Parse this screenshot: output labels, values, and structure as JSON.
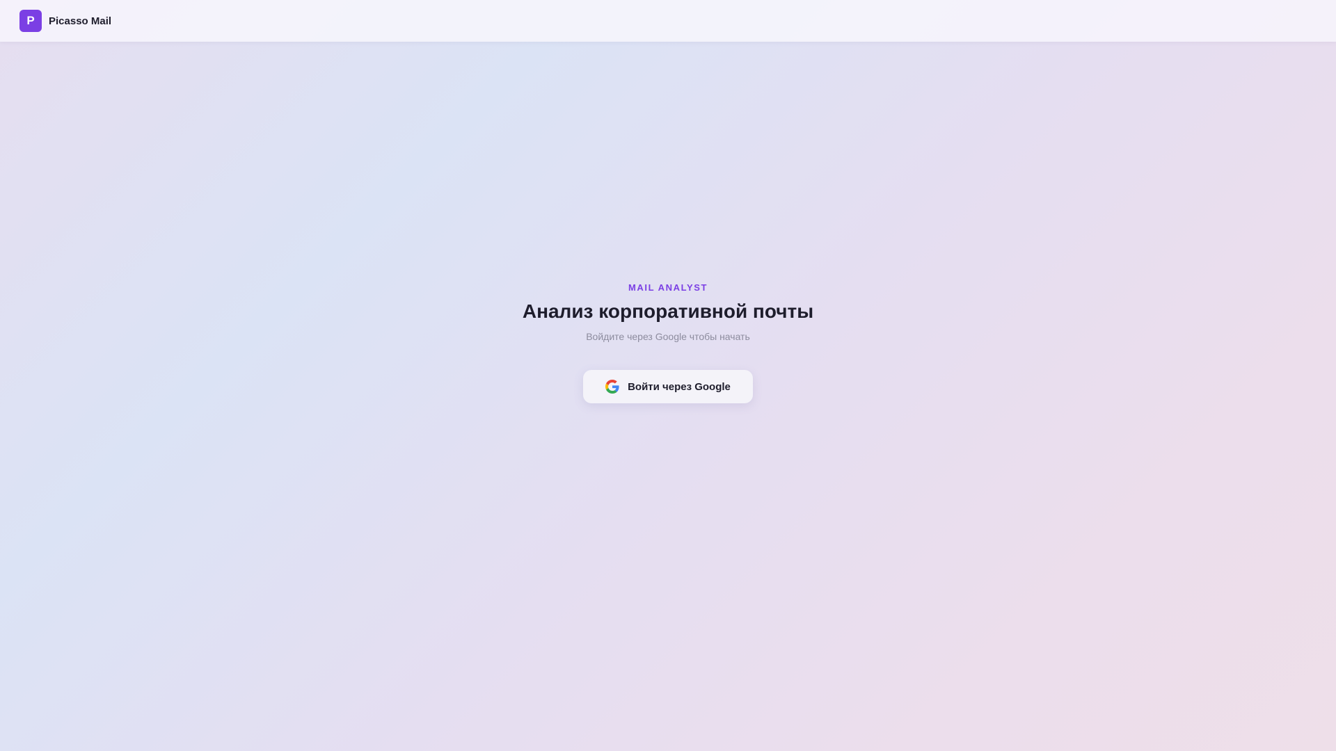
{
  "header": {
    "logo_letter": "P",
    "app_name": "Picasso Mail"
  },
  "hero": {
    "eyebrow": "MAIL ANALYST",
    "title": "Анализ корпоративной почты",
    "subtitle": "Войдите через Google чтобы начать",
    "signin_button": {
      "label": "Войти через Google",
      "icon": "google-logo-icon"
    }
  },
  "colors": {
    "accent": "#7b3fe4",
    "text_primary": "#1e1d2c",
    "text_muted": "#8d8c9e"
  }
}
